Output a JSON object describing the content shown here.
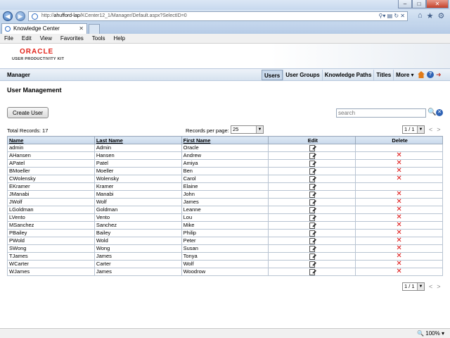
{
  "browser": {
    "url_prefix": "http://",
    "url_host": "ahufford-lap",
    "url_path": "/KCenter12_1/Manager/Default.aspx?SelectID=0",
    "tab_title": "Knowledge Center",
    "menu": [
      "File",
      "Edit",
      "View",
      "Favorites",
      "Tools",
      "Help"
    ],
    "zoom": "100%"
  },
  "header": {
    "logo_text": "ORACLE",
    "logo_subtitle": "USER PRODUCTIVITY KIT",
    "brand_color": "#e2231a"
  },
  "appbar": {
    "title": "Manager",
    "nav": [
      "Users",
      "User Groups",
      "Knowledge Paths",
      "Titles",
      "More ▾"
    ],
    "active_nav": "Users"
  },
  "main": {
    "section_title": "User Management",
    "create_button": "Create User",
    "search_placeholder": "search",
    "total_records": "Total Records: 17",
    "records_per_page_label": "Records per page:",
    "records_per_page_value": "25",
    "page_indicator": "1 / 1"
  },
  "table": {
    "columns": [
      "Name",
      "Last Name",
      "First Name",
      "Edit",
      "Delete"
    ],
    "rows": [
      {
        "name": "admin",
        "last": "Admin",
        "first": "Oracle",
        "deletable": false
      },
      {
        "name": "AHansen",
        "last": "Hansen",
        "first": "Andrew",
        "deletable": true
      },
      {
        "name": "APatel",
        "last": "Patel",
        "first": "Amiya",
        "deletable": true
      },
      {
        "name": "BMoeller",
        "last": "Moeller",
        "first": "Ben",
        "deletable": true
      },
      {
        "name": "CWolensky",
        "last": "Wolensky",
        "first": "Carol",
        "deletable": true
      },
      {
        "name": "EKramer",
        "last": "Kramer",
        "first": "Elaine",
        "deletable": false
      },
      {
        "name": "JManabi",
        "last": "Manabi",
        "first": "John",
        "deletable": true
      },
      {
        "name": "JWolf",
        "last": "Wolf",
        "first": "James",
        "deletable": true
      },
      {
        "name": "LGoldman",
        "last": "Goldman",
        "first": "Leanne",
        "deletable": true
      },
      {
        "name": "LVento",
        "last": "Vento",
        "first": "Lou",
        "deletable": true
      },
      {
        "name": "MSanchez",
        "last": "Sanchez",
        "first": "Mike",
        "deletable": true
      },
      {
        "name": "PBailey",
        "last": "Bailey",
        "first": "Philip",
        "deletable": true
      },
      {
        "name": "PWold",
        "last": "Wold",
        "first": "Peter",
        "deletable": true
      },
      {
        "name": "SWong",
        "last": "Wong",
        "first": "Susan",
        "deletable": true
      },
      {
        "name": "TJames",
        "last": "James",
        "first": "Tonya",
        "deletable": true
      },
      {
        "name": "WCarter",
        "last": "Carter",
        "first": "Wolf",
        "deletable": true
      },
      {
        "name": "WJames",
        "last": "James",
        "first": "Woodrow",
        "deletable": true
      }
    ]
  }
}
